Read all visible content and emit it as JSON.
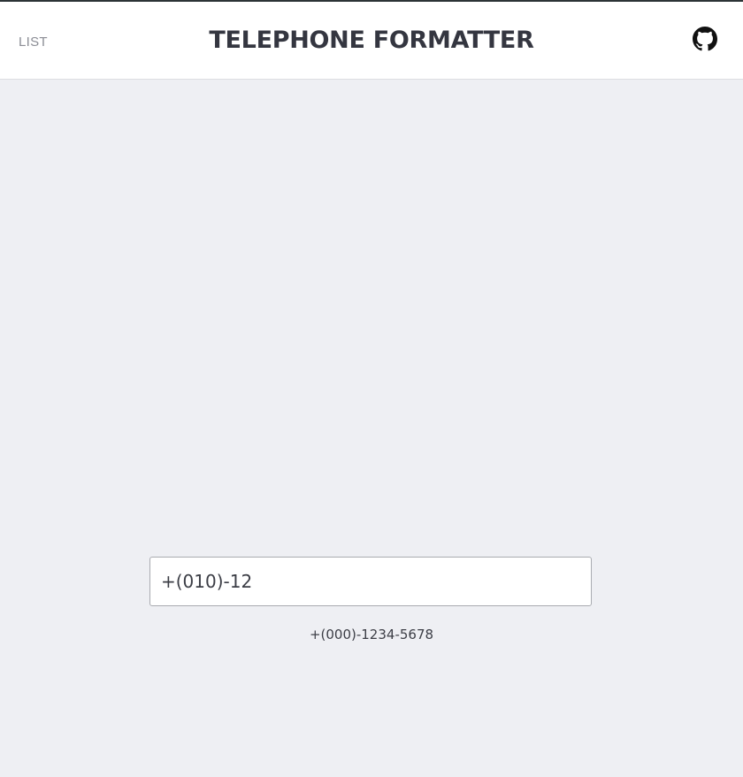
{
  "header": {
    "nav_label": "LIST",
    "title": "TELEPHONE FORMATTER",
    "github_icon": "github-icon"
  },
  "main": {
    "phone_value": "+(010)-12",
    "format_hint": "+(000)-1234-5678"
  },
  "colors": {
    "background": "#eeeff3",
    "header_background": "#ffffff",
    "header_top_border": "#2c3436",
    "title_text": "#343640",
    "nav_text": "#8b8d95",
    "body_text": "#3c3e46"
  }
}
